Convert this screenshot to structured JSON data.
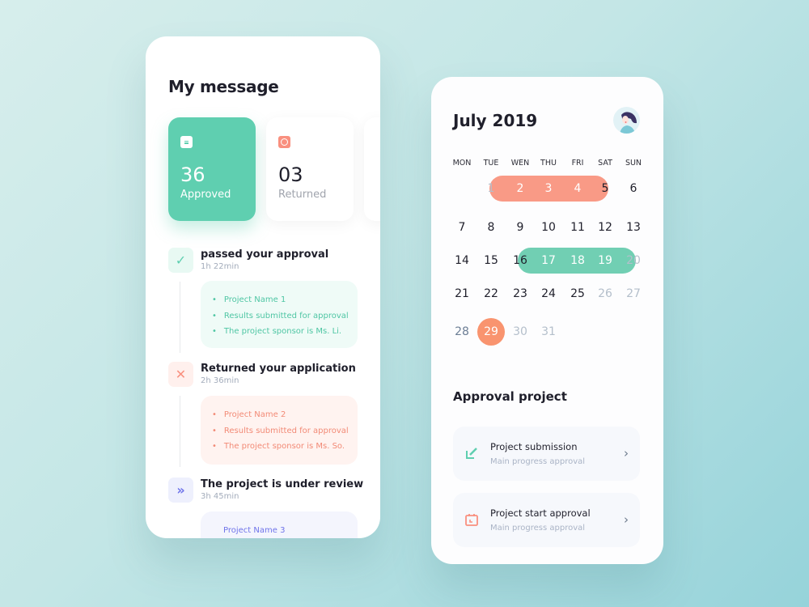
{
  "left": {
    "title": "My message",
    "stats": [
      {
        "value": "36",
        "label": "Approved",
        "icon": "document-icon"
      },
      {
        "value": "03",
        "label": "Returned",
        "icon": "clock-icon"
      }
    ],
    "activities": [
      {
        "title": "passed your approval",
        "time": "1h 22min",
        "icon": "check-icon",
        "items": [
          "Project Name 1",
          "Results submitted for approval",
          "The project sponsor is Ms. Li."
        ]
      },
      {
        "title": "Returned your application",
        "time": "2h 36min",
        "icon": "close-icon",
        "items": [
          "Project Name 2",
          "Results submitted for approval",
          "The project sponsor is Ms. So."
        ]
      },
      {
        "title": "The project is under review",
        "time": "3h 45min",
        "icon": "double-chevron-icon",
        "items": [
          "Project Name 3"
        ]
      }
    ]
  },
  "calendar": {
    "month": "July 2019",
    "weekdays": [
      "MON",
      "TUE",
      "WEN",
      "THU",
      "FRI",
      "SAT",
      "SUN"
    ],
    "weeks": [
      [
        "",
        "1",
        "2",
        "3",
        "4",
        "5",
        "6"
      ],
      [
        "7",
        "8",
        "9",
        "10",
        "11",
        "12",
        "13"
      ],
      [
        "14",
        "15",
        "16",
        "17",
        "18",
        "19",
        "20"
      ],
      [
        "21",
        "22",
        "23",
        "24",
        "25",
        "26",
        "27"
      ],
      [
        "28",
        "29",
        "30",
        "31",
        "",
        "",
        ""
      ]
    ],
    "highlight_ranges": [
      {
        "days": [
          "2",
          "3",
          "4"
        ],
        "color": "#f99a86"
      },
      {
        "days": [
          "17",
          "18",
          "19"
        ],
        "color": "#71cfb3"
      }
    ],
    "selected_day": "29",
    "muted_days": [
      "1",
      "20",
      "26",
      "27",
      "30",
      "31"
    ]
  },
  "approval": {
    "title": "Approval project",
    "items": [
      {
        "title": "Project submission",
        "subtitle": "Main progress approval",
        "icon": "edit-icon"
      },
      {
        "title": "Project start approval",
        "subtitle": "Main progress approval",
        "icon": "calendar-icon"
      }
    ]
  },
  "colors": {
    "green": "#5fcfb0",
    "coral": "#f9907f",
    "indigo": "#6f74ea"
  }
}
